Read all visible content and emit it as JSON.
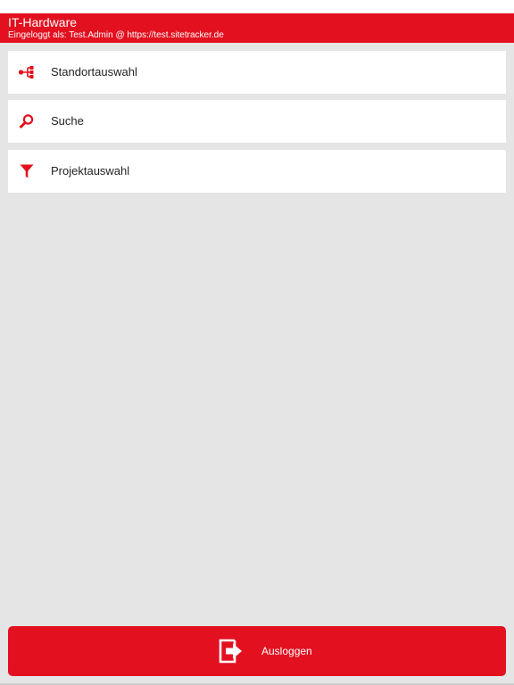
{
  "header": {
    "title": "IT-Hardware",
    "subtitle": "Eingeloggt als: Test.Admin @ https://test.sitetracker.de"
  },
  "menu": {
    "items": [
      {
        "label": "Standortauswahl",
        "icon": "sitemap-icon"
      },
      {
        "label": "Suche",
        "icon": "search-icon"
      },
      {
        "label": "Projektauswahl",
        "icon": "filter-icon"
      }
    ]
  },
  "logout": {
    "label": "Ausloggen",
    "icon": "logout-icon"
  },
  "colors": {
    "accent": "#e3101f",
    "background": "#e5e5e5",
    "card": "#ffffff"
  }
}
